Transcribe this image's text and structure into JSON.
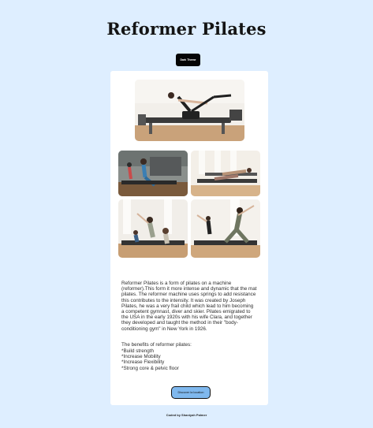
{
  "header": {
    "title": "Reformer Pilates",
    "theme_button_label": "Dark Theme"
  },
  "card": {
    "images": [
      {
        "name": "main-reformer-photo",
        "alt": "Reformer pilates"
      },
      {
        "name": "class-photo-1",
        "alt": "Reformer pilates class"
      },
      {
        "name": "class-photo-2",
        "alt": "Reformer pilates class"
      },
      {
        "name": "class-photo-3",
        "alt": "Reformer pilates class"
      },
      {
        "name": "class-photo-4",
        "alt": "Reformer pilates class"
      }
    ],
    "description": "Reformer Pilates is a form of pilates on a machine (reformer).This form it more intense and dynamic that the mat pilates. The reformer machine uses springs to add resistance this contributes to the intensity. It was created by Joseph Pilates, he was a very frail child which lead to him becoming a competent gymnast, diver and skier. Pilates emigrated to the USA in the early 1920s with his wife Clara, and together they developed and taught the method in their \"body-conditioning gym\" in New York in 1926.",
    "benefits_heading": "The benefits of reformer pilates:",
    "benefits": [
      "*Build strength",
      "*Increase Mobility",
      "*Increase Flexibility",
      "*Strong core & pelvic floor"
    ],
    "location_button_label": "Discover la location"
  },
  "footer": {
    "credit": "Coded by Shaniyah Palmer"
  },
  "colors": {
    "page_background": "#deeeff",
    "card_background": "#ffffff",
    "theme_button": "#050505",
    "location_button": "#7fb8ee"
  }
}
